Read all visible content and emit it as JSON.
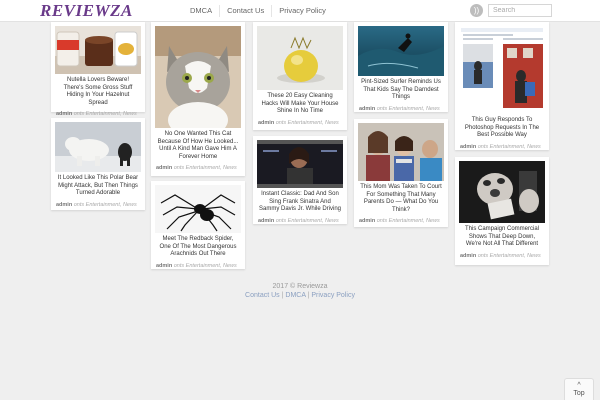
{
  "header": {
    "logo": "REVIEWZA",
    "nav": [
      "DMCA",
      "Contact Us",
      "Privacy Policy"
    ],
    "search_placeholder": "Search"
  },
  "cards": [
    {
      "title": "Nutella Lovers Beware! There's Some Gross Stuff Hiding In Your Hazelnut Spread",
      "author": "admin",
      "meta": "onts  Entertainment, News"
    },
    {
      "title": "It Looked Like This Polar Bear Might Attack, But Then Things Turned Adorable",
      "author": "admin",
      "meta": "onts  Entertainment, News"
    },
    {
      "title": "No One Wanted This Cat Because Of How He Looked... Until A Kind Man Gave Him A Forever Home",
      "author": "admin",
      "meta": "onts  Entertainment, News"
    },
    {
      "title": "Meet The Redback Spider, One Of The Most Dangerous Arachnids Out There",
      "author": "admin",
      "meta": "onts  Entertainment, News"
    },
    {
      "title": "These 20 Easy Cleaning Hacks Will Make Your House Shine In No Time",
      "author": "admin",
      "meta": "onts  Entertainment, News"
    },
    {
      "title": "Instant Classic: Dad And Son Sing Frank Sinatra And Sammy Davis Jr. While Driving",
      "author": "admin",
      "meta": "onts  Entertainment, News"
    },
    {
      "title": "Pint-Sized Surfer Reminds Us That Kids Say The Darndest Things",
      "author": "admin",
      "meta": "onts  Entertainment, News"
    },
    {
      "title": "This Mom Was Taken To Court For Something That Many Parents Do — What Do You Think?",
      "author": "admin",
      "meta": "onts  Entertainment, News"
    },
    {
      "title": "This Guy Responds To Photoshop Requests In The Best Possible Way",
      "author": "admin",
      "meta": "onts  Entertainment, News"
    },
    {
      "title": "This Campaign Commercial Shows That Deep Down, We're Not All That Different",
      "author": "admin",
      "meta": "onts  Entertainment, News"
    }
  ],
  "footer": {
    "copyright": "2017 © Reviewza",
    "links": [
      "Contact Us",
      "DMCA",
      "Privacy Policy"
    ]
  },
  "top_button": {
    "icon": "chevron-up-icon",
    "label": "Top"
  },
  "colors": {
    "logo": "#6a3a8a",
    "background": "#efefef",
    "card": "#ffffff"
  }
}
